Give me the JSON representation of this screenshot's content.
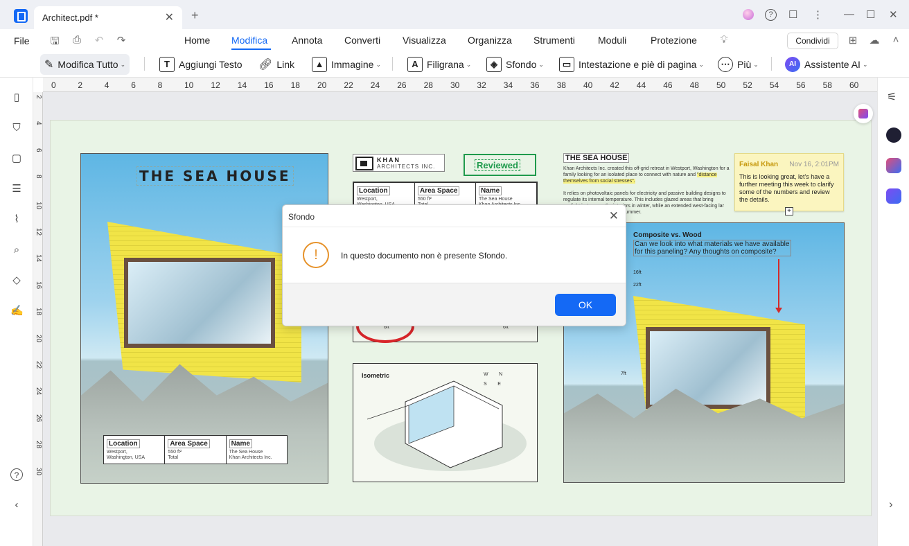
{
  "window": {
    "tab_title": "Architect.pdf *",
    "tab_close": "✕",
    "new_tab": "+"
  },
  "titlebar_icons": {
    "help": "?",
    "feedback": "☐",
    "more": "⋮",
    "minimize": "—",
    "maximize": "☐",
    "close": "✕"
  },
  "menu": {
    "file": "File",
    "items": [
      "Home",
      "Modifica",
      "Annota",
      "Converti",
      "Visualizza",
      "Organizza",
      "Strumenti",
      "Moduli",
      "Protezione"
    ],
    "active": "Modifica",
    "share": "Condividi"
  },
  "toolbar": {
    "edit_all": "Modifica Tutto",
    "add_text": "Aggiungi Testo",
    "link": "Link",
    "image": "Immagine",
    "watermark": "Filigrana",
    "background": "Sfondo",
    "header_footer": "Intestazione e piè di pagina",
    "more": "Più",
    "ai_assistant": "Assistente AI",
    "ai_badge": "AI"
  },
  "ruler": {
    "top": [
      "0",
      "2",
      "4",
      "6",
      "8",
      "10",
      "12",
      "14",
      "16",
      "18",
      "20",
      "22",
      "24",
      "26",
      "28",
      "30",
      "32",
      "34",
      "36",
      "38",
      "40",
      "42",
      "44",
      "46",
      "48",
      "50",
      "52",
      "54",
      "56",
      "58",
      "60"
    ],
    "left": [
      "2",
      "4",
      "6",
      "8",
      "10",
      "12",
      "14",
      "16",
      "18",
      "20",
      "22",
      "24",
      "26",
      "28",
      "30"
    ]
  },
  "document": {
    "house_title": "THE SEA HOUSE",
    "left_table": {
      "headers": [
        "Location",
        "Area Space",
        "Name"
      ],
      "values": [
        [
          "Westport,",
          "Washington, USA"
        ],
        [
          "550 ft²",
          "Total"
        ],
        [
          "The Sea House",
          "Khan Architects Inc."
        ]
      ]
    },
    "khan_name": "KHAN",
    "khan_sub": "ARCHITECTS INC.",
    "reviewed": "Reviewed",
    "mid_table": {
      "headers": [
        "Location",
        "Area Space",
        "Name"
      ],
      "values": [
        [
          "Westport,",
          "Washington, USA"
        ],
        [
          "550 ft²",
          "Total"
        ],
        [
          "The Sea House",
          "Khan Architects Inc."
        ]
      ]
    },
    "mid_dim_a": "6ft",
    "mid_dim_b": "6ft",
    "isometric_label": "Isometric",
    "compass": [
      "W",
      "N",
      "S",
      "E"
    ],
    "text_title": "THE SEA HOUSE",
    "text_body_1": "Khan Architects Inc. created this off-grid retreat in Westport, Washington for a family looking for an isolated place to connect with nature and",
    "text_highlight": "\"distance themselves from social stresses\".",
    "text_body_2": "It relies on photovoltaic panels for electricity and passive building designs to regulate its internal temperature. This includes glazed areas that bring sunlight in to warm the interiors in winter, while an extended west-facing",
    "text_body_3": "lar heat during evenings in the summer.",
    "note": {
      "author": "Faisal Khan",
      "date": "Nov 16, 2:01PM",
      "text": "This is looking great, let's have a further meeting this week to clarify some of the numbers and review the details.",
      "plus": "+"
    },
    "comment": {
      "title": "Composite vs. Wood",
      "text": "Can we look into what materials we have available for this paneling? Any thoughts on composite?"
    },
    "right_dims": [
      "16ft",
      "22ft",
      "8ft",
      "7ft"
    ]
  },
  "dialog": {
    "title": "Sfondo",
    "close": "✕",
    "icon": "!",
    "message": "In questo documento non è presente Sfondo.",
    "ok": "OK"
  },
  "colors": {
    "accent": "#1469f5",
    "warning": "#e6922a",
    "reviewed": "#1f9a4c",
    "page_bg": "#e9f4e6"
  }
}
